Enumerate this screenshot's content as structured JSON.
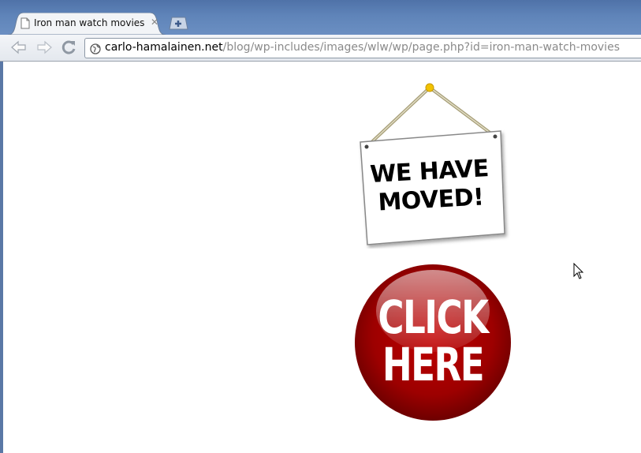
{
  "browser": {
    "tab": {
      "title": "Iron man watch movies"
    },
    "address_bar": {
      "host": "carlo-hamalainen.net",
      "path": "/blog/wp-includes/images/wlw/wp/page.php?id=iron-man-watch-movies"
    }
  },
  "page": {
    "sign": {
      "line1": "WE HAVE",
      "line2": "MOVED!"
    },
    "button": {
      "line1": "CLICK",
      "line2": "HERE"
    }
  },
  "colors": {
    "titlebar": "#5f84b9",
    "button_red": "#8b0000",
    "url_host": "#000000",
    "url_path": "#8a8a8a"
  }
}
